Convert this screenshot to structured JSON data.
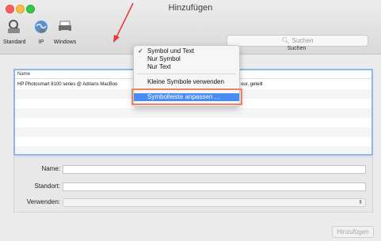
{
  "window": {
    "title": "Hinzufügen"
  },
  "toolbar": {
    "items": [
      {
        "label": "Standard",
        "icon": "printer-magnifier-icon"
      },
      {
        "label": "IP",
        "icon": "globe-icon"
      },
      {
        "label": "Windows",
        "icon": "windows-printer-icon"
      }
    ],
    "search_placeholder": "Suchen",
    "search_label": "Suchen"
  },
  "list": {
    "column_name": "Name",
    "rows": [
      {
        "name": "HP Photosmart 8100 series @ Adrians MacBoo",
        "kind": "our, geteilt"
      }
    ]
  },
  "form": {
    "name_label": "Name:",
    "location_label": "Standort:",
    "use_label": "Verwenden:"
  },
  "add_button": "Hinzufügen",
  "context_menu": {
    "items": [
      {
        "label": "Symbol und Text",
        "checked": true
      },
      {
        "label": "Nur Symbol",
        "checked": false
      },
      {
        "label": "Nur Text",
        "checked": false
      },
      {
        "label": "Kleine Symbole verwenden",
        "checked": false
      },
      {
        "label": "Symbolleiste anpassen ...",
        "checked": false,
        "highlighted": true
      }
    ],
    "check_glyph": "✓"
  },
  "colors": {
    "highlight_border": "#e9855f",
    "menu_highlight": "#4a8cf0",
    "arrow": "#e53935"
  }
}
